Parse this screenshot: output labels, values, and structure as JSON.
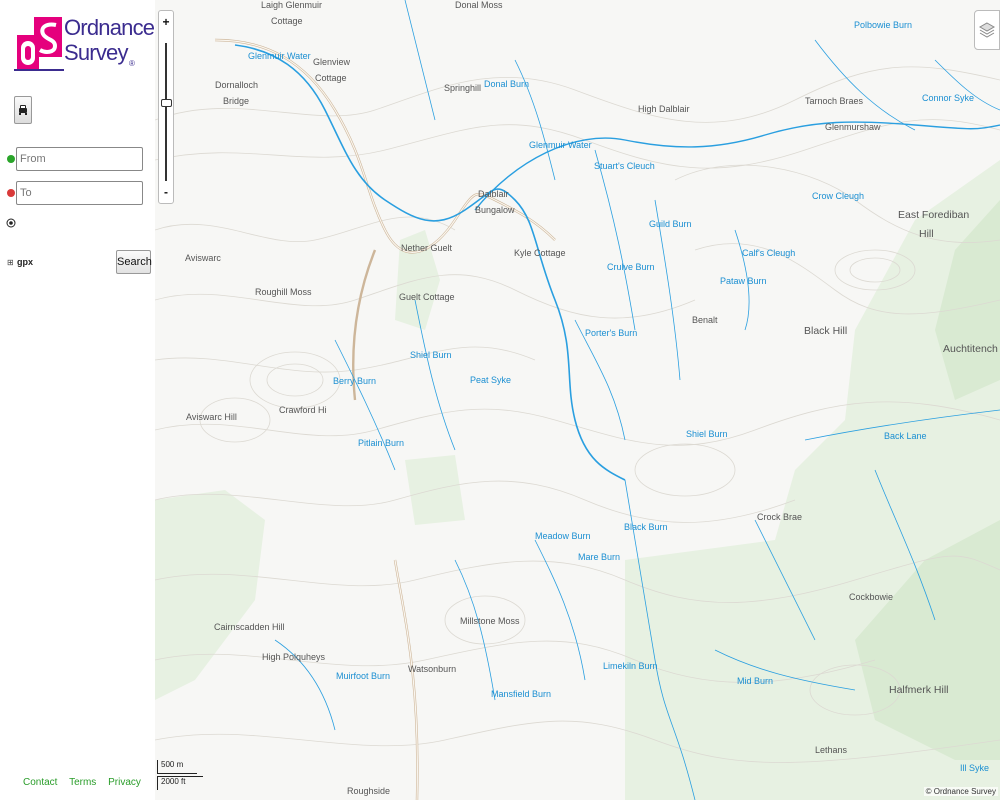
{
  "brand": {
    "line1": "Ordnance",
    "line2": "Survey",
    "reg": "®",
    "mark_color": "#e5007d",
    "text_color": "#3b2c8f"
  },
  "route": {
    "from_placeholder": "From",
    "to_placeholder": "To",
    "gpx_label": "gpx",
    "search_label": "Search"
  },
  "footer": {
    "contact": "Contact",
    "terms": "Terms",
    "privacy": "Privacy"
  },
  "map": {
    "zoom_in": "+",
    "zoom_out": "-",
    "scale_metric": "500 m",
    "scale_imperial": "2000 ft",
    "attribution": "© Ordnance Survey",
    "colors": {
      "water": "#1b8fd2",
      "contour": "#d9d6cf",
      "forest": "#e6f0e0",
      "road": "#cdb69a"
    },
    "place_labels": [
      "Laigh Glenmuir",
      "Cottage",
      "Donal Moss",
      "Polbowie Burn",
      "Glenmuir Water",
      "Glenview",
      "Cottage",
      "Dornalloch",
      "Bridge",
      "Springhill",
      "Donal Burn",
      "High Dalblair",
      "Tarnoch Braes",
      "Glenmurshaw",
      "Connor Syke",
      "Glenmuir Water",
      "Stuart's Cleuch",
      "Crow Cleugh",
      "Dalblair",
      "Bungalow",
      "East Forediban",
      "Hill",
      "Guild Burn",
      "Nether Guelt",
      "Kyle Cottage",
      "Calf's Cleugh",
      "Aviswarc",
      "Crulve Burn",
      "Pataw Burn",
      "Roughill Moss",
      "Guelt Cottage",
      "Benalt",
      "Black Hill",
      "Porter's Burn",
      "Auchtitench Hill",
      "Shiel Burn",
      "Berry Burn",
      "Peat Syke",
      "Crawford Hi",
      "Aviswarc Hill",
      "Shiel Burn",
      "Back Lane",
      "Pitlain Burn",
      "Black Burn",
      "Crock Brae",
      "Meadow Burn",
      "Mare Burn",
      "Cockbowie",
      "Cairnscadden Hill",
      "Millstone Moss",
      "High Polquheys",
      "Limekiln Burn",
      "Watsonburn",
      "Muirfoot Burn",
      "Mid Burn",
      "Halfmerk Hill",
      "Mansfield Burn",
      "Lethans",
      "Roughside",
      "Ill Syke"
    ]
  }
}
